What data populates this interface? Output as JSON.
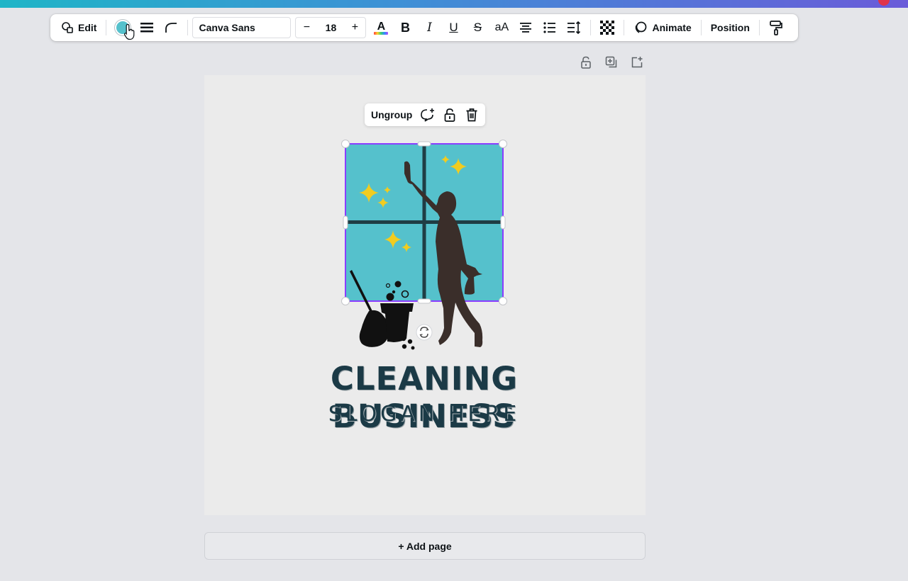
{
  "colors": {
    "accent_gradient_start": "#1fb5c7",
    "accent_gradient_end": "#6a5bd9",
    "text_color_swatch": "#55c1cc",
    "selection": "#8b3dff",
    "window_fill": "#55c1cc",
    "window_frame": "#1f3d44",
    "sparkle": "#f2cc1f",
    "silhouette": "#3a2e2a",
    "title_text": "#1b3a46",
    "canvas_bg": "#ebebeb",
    "workspace_bg": "#e4e5e9"
  },
  "toolbar": {
    "edit_label": "Edit",
    "font_name": "Canva Sans",
    "font_size": "18",
    "decrease_symbol": "−",
    "increase_symbol": "+",
    "text_color_glyph": "A",
    "bold_glyph": "B",
    "italic_glyph": "I",
    "underline_glyph": "U",
    "strikethrough_glyph": "S",
    "letter_case_glyph": "aA",
    "animate_label": "Animate",
    "position_label": "Position",
    "icons": [
      "shape-edit-icon",
      "color-swatch",
      "border-style-icon",
      "corner-rounding-icon",
      "text-color-icon",
      "bold-icon",
      "italic-icon",
      "underline-icon",
      "strikethrough-icon",
      "letter-case-icon",
      "align-center-icon",
      "list-icon",
      "spacing-icon",
      "transparency-icon",
      "animate-icon",
      "paint-roller-icon"
    ]
  },
  "page_actions": {
    "icons": [
      "lock-icon",
      "duplicate-page-icon",
      "add-page-icon"
    ]
  },
  "selection_bar": {
    "ungroup_label": "Ungroup",
    "icons": [
      "comment-add-icon",
      "lock-icon",
      "trash-icon"
    ]
  },
  "design": {
    "title": "CLEANING BUSINESS",
    "slogan": "SLOGAN HERE"
  },
  "add_page_label": "+ Add page"
}
